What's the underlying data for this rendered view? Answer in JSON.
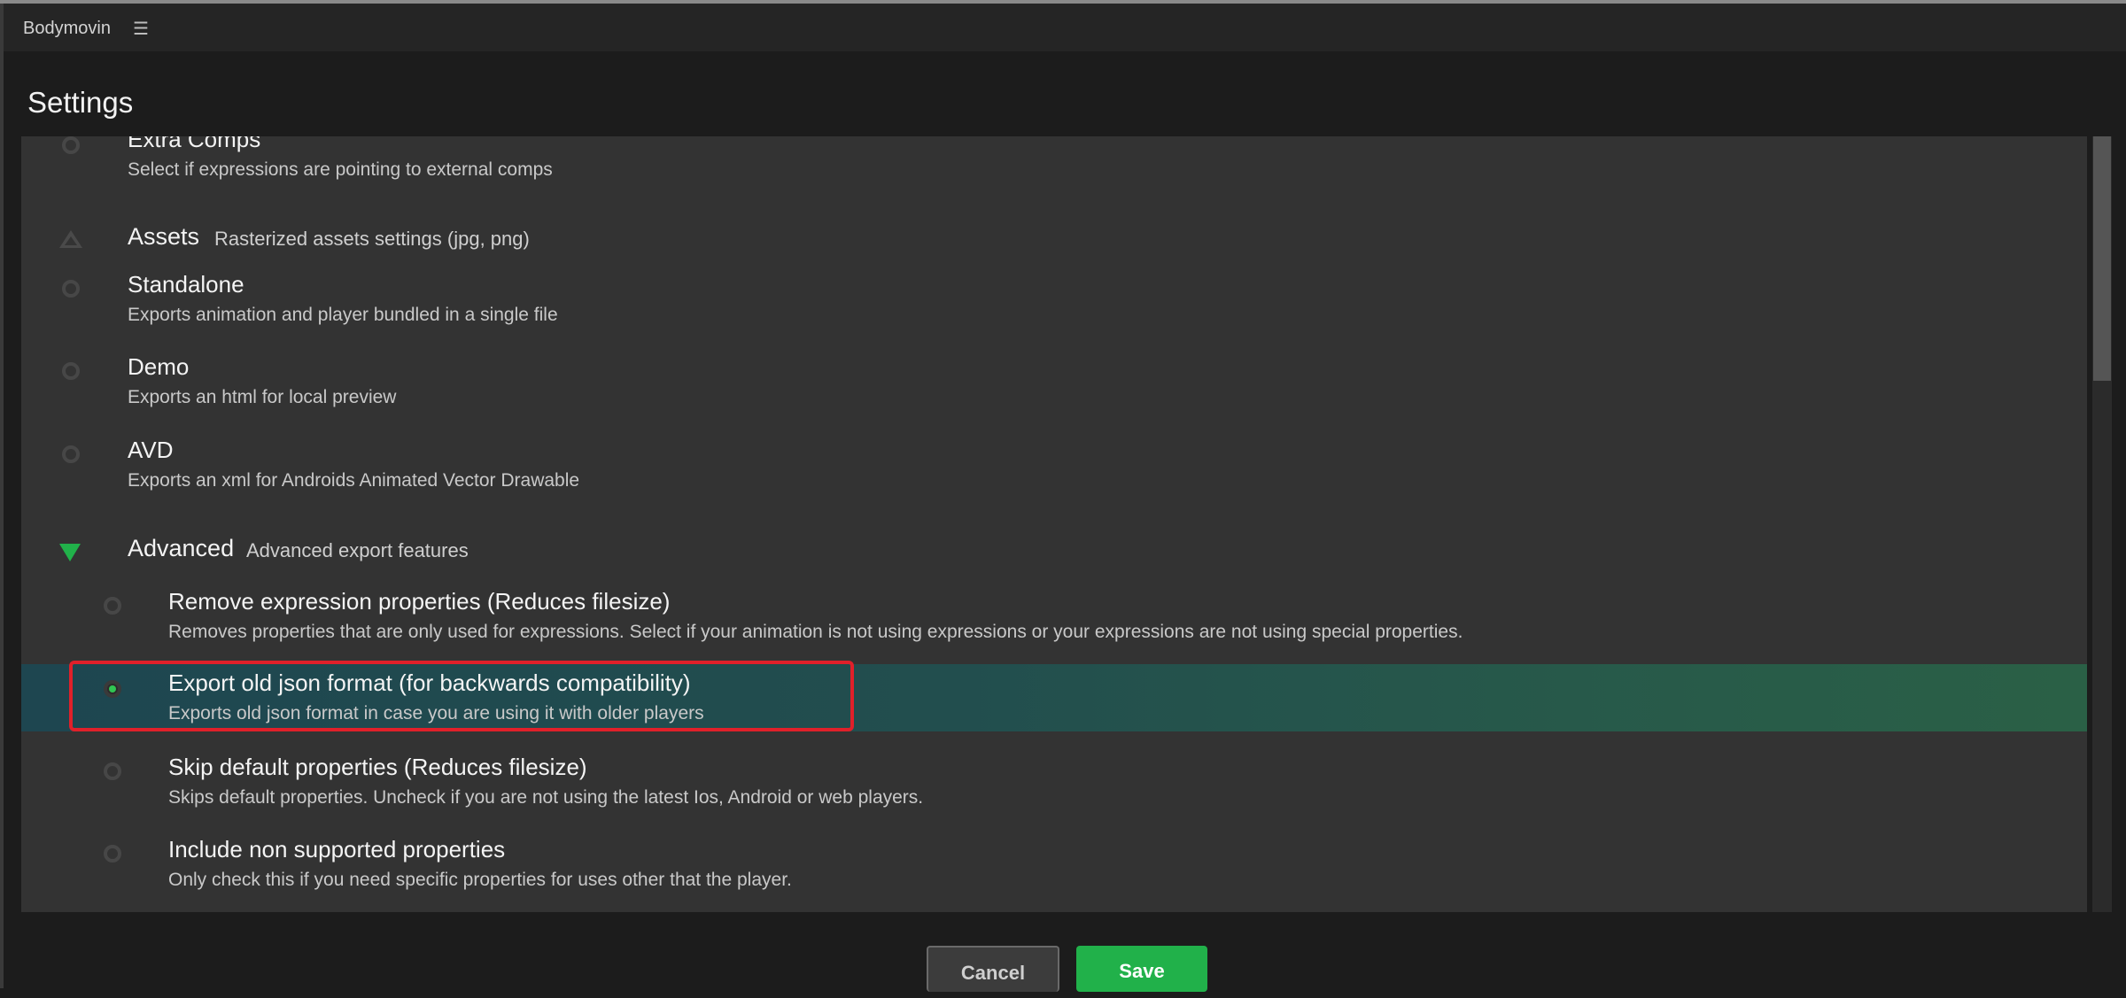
{
  "app": {
    "name": "Bodymovin",
    "menu_icon": "hamburger-menu-icon"
  },
  "page": {
    "title": "Settings"
  },
  "items_top": [
    {
      "title": "Extra Comps",
      "desc": "Select if expressions are pointing to external comps",
      "selected": false
    }
  ],
  "assets_section": {
    "title": "Assets",
    "subtitle": "Rasterized assets settings (jpg, png)",
    "icon": "collapsed-triangle-icon",
    "items": [
      {
        "title": "Standalone",
        "desc": "Exports animation and player bundled in a single file",
        "selected": false
      },
      {
        "title": "Demo",
        "desc": "Exports an html for local preview",
        "selected": false
      },
      {
        "title": "AVD",
        "desc": "Exports an xml for Androids Animated Vector Drawable",
        "selected": false
      }
    ]
  },
  "advanced_section": {
    "title": "Advanced",
    "subtitle": "Advanced export features",
    "icon": "expanded-triangle-icon",
    "accent": "#21b14a",
    "items": [
      {
        "title": "Remove expression properties (Reduces filesize)",
        "desc": "Removes properties that are only used for expressions. Select if your animation is not using expressions or your expressions are not using special properties.",
        "selected": false
      },
      {
        "title": "Export old json format (for backwards compatibility)",
        "desc": "Exports old json format in case you are using it with older players",
        "selected": true
      },
      {
        "title": "Skip default properties (Reduces filesize)",
        "desc": "Skips default properties. Uncheck if you are not using the latest Ios, Android or web players.",
        "selected": false
      },
      {
        "title": "Include non supported properties",
        "desc": "Only check this if you need specific properties for uses other that the player.",
        "selected": false
      }
    ]
  },
  "footer": {
    "cancel_label": "Cancel",
    "save_label": "Save",
    "save_color": "#21b14a",
    "highlight_outline_color": "#e0202a"
  }
}
